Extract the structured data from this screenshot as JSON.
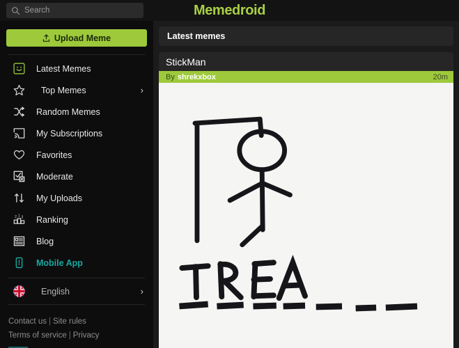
{
  "topbar": {
    "search_placeholder": "Search",
    "search_value": "",
    "search_icon": "search-icon",
    "brand": "Memedroid"
  },
  "sidebar": {
    "upload_button": {
      "label": "Upload Meme",
      "icon": "upload-icon",
      "bg_color": "#9dc93b"
    },
    "items": [
      {
        "label": "Latest Memes",
        "icon": "smiley-square-icon",
        "active": true,
        "chevron": false,
        "indent": false,
        "accent": false
      },
      {
        "label": "Top Memes",
        "icon": "star-icon",
        "active": false,
        "chevron": true,
        "indent": true,
        "accent": false
      },
      {
        "label": "Random Memes",
        "icon": "shuffle-icon",
        "active": false,
        "chevron": false,
        "indent": false,
        "accent": false
      },
      {
        "label": "My Subscriptions",
        "icon": "subscription-icon",
        "active": false,
        "chevron": false,
        "indent": false,
        "accent": false
      },
      {
        "label": "Favorites",
        "icon": "heart-icon",
        "active": false,
        "chevron": false,
        "indent": false,
        "accent": false
      },
      {
        "label": "Moderate",
        "icon": "moderate-icon",
        "active": false,
        "chevron": false,
        "indent": false,
        "accent": false
      },
      {
        "label": "My Uploads",
        "icon": "up-down-arrows-icon",
        "active": false,
        "chevron": false,
        "indent": false,
        "accent": false
      },
      {
        "label": "Ranking",
        "icon": "podium-icon",
        "active": false,
        "chevron": false,
        "indent": false,
        "accent": false
      },
      {
        "label": "Blog",
        "icon": "blog-list-icon",
        "active": false,
        "chevron": false,
        "indent": false,
        "accent": false
      },
      {
        "label": "Mobile App",
        "icon": "mobile-phone-icon",
        "active": false,
        "chevron": false,
        "indent": false,
        "accent": true
      }
    ],
    "language": {
      "label": "English",
      "icon": "uk-flag-icon",
      "chevron": "›"
    },
    "footer": {
      "row1": [
        "Contact us",
        "Site rules"
      ],
      "row2": [
        "Terms of service",
        "Privacy"
      ],
      "separator": "|"
    },
    "accent_color": "#19a7a0"
  },
  "main": {
    "panel_title": "Latest memes",
    "meme": {
      "title": "StickMan",
      "by_word": "By",
      "author": "shrekxbox",
      "time": "20m",
      "byline_bg": "#9dc93b",
      "image_alt": "hangman-drawing-with-letters-TREA-and-blanks"
    }
  },
  "colors": {
    "page_bg": "#0d0d0d",
    "topbar_bg": "#131313",
    "main_bg": "#1b1b1b",
    "card_bg": "#262626",
    "brand_green": "#a9cf45",
    "button_green": "#9dc93b",
    "teal": "#19a7a0"
  }
}
